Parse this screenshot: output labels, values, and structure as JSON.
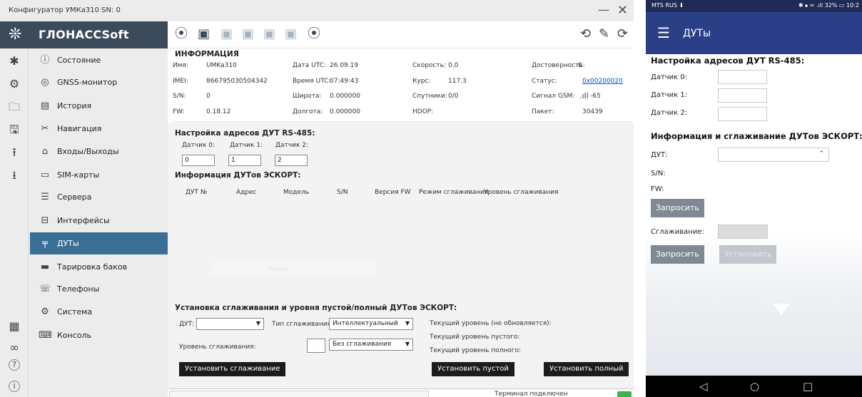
{
  "window": {
    "title": "Конфигуратор     УМКа310 SN: 0",
    "minimize": "—",
    "close": "✕"
  },
  "sidebar": {
    "logo_icon": "snowflake-logo-icon",
    "logo_text": "ГЛОНАССSoft",
    "rail": [
      {
        "icon": "bluetooth-icon",
        "glyph": "✱"
      },
      {
        "icon": "device-icon",
        "glyph": "⚙"
      },
      {
        "icon": "folder-icon",
        "glyph": "🗀"
      },
      {
        "icon": "save-icon",
        "glyph": "🖫"
      },
      {
        "icon": "upload-icon",
        "glyph": "⭱"
      },
      {
        "icon": "download-icon",
        "glyph": "⭳"
      },
      {
        "icon": "grid-icon",
        "glyph": "▦"
      },
      {
        "icon": "link-icon",
        "glyph": "∞"
      },
      {
        "icon": "help-icon",
        "glyph": "?"
      },
      {
        "icon": "info-icon",
        "glyph": "i"
      }
    ],
    "items": [
      {
        "label": "Состояние",
        "icon": "info-circle-icon",
        "glyph": "ⓘ"
      },
      {
        "label": "GNSS-монитор",
        "icon": "satellite-icon",
        "glyph": "◎"
      },
      {
        "label": "История",
        "icon": "book-icon",
        "glyph": "▤"
      },
      {
        "label": "Навигация",
        "icon": "navigation-icon",
        "glyph": "✂"
      },
      {
        "label": "Входы/Выходы",
        "icon": "io-icon",
        "glyph": "⌂"
      },
      {
        "label": "SIM-карты",
        "icon": "sim-card-icon",
        "glyph": "▭"
      },
      {
        "label": "Сервера",
        "icon": "server-icon",
        "glyph": "☰"
      },
      {
        "label": "Интерфейсы",
        "icon": "interface-icon",
        "glyph": "⊟"
      },
      {
        "label": "ДУТы",
        "icon": "fuel-sensor-icon",
        "glyph": "╤"
      },
      {
        "label": "Тарировка баков",
        "icon": "tank-icon",
        "glyph": "▬"
      },
      {
        "label": "Телефоны",
        "icon": "phone-icon",
        "glyph": "☏"
      },
      {
        "label": "Система",
        "icon": "system-gear-icon",
        "glyph": "⚙"
      },
      {
        "label": "Консоль",
        "icon": "console-icon",
        "glyph": "⌨"
      }
    ],
    "active_index": 8
  },
  "toolbar": {
    "left_icons": [
      {
        "icon": "wireless-device-icon",
        "glyph": "📶"
      },
      {
        "icon": "chip-read-icon",
        "glyph": "▣"
      },
      {
        "icon": "chip-write-icon",
        "glyph": "▣"
      },
      {
        "icon": "chip-icon",
        "glyph": "▣"
      },
      {
        "icon": "chip-upload-icon",
        "glyph": "▣"
      },
      {
        "icon": "chip-settings-icon",
        "glyph": "▣"
      },
      {
        "icon": "location-off-icon",
        "glyph": "⦿"
      }
    ],
    "right_icons": [
      {
        "icon": "refresh-doc-icon",
        "glyph": "⟲"
      },
      {
        "icon": "satellite-dish-icon",
        "glyph": "✎"
      },
      {
        "icon": "play-replay-icon",
        "glyph": "⟳"
      }
    ]
  },
  "info": {
    "title": "ИНФОРМАЦИЯ",
    "name_label": "Имя:",
    "name": "UMKa310",
    "imei_label": "IMEI:",
    "imei": "866795030504342",
    "sn_label": "S/N:",
    "sn": "0",
    "fw_label": "FW:",
    "fw": "0.18.12",
    "date_label": "Дата UTC:",
    "date": "26.09.19",
    "time_label": "Время UTC:",
    "time": "07:49:43",
    "lat_label": "Широта:",
    "lat": "0.000000",
    "lon_label": "Долгота:",
    "lon": "0.000000",
    "speed_label": "Скорость:",
    "speed": "0.0",
    "course_label": "Курс:",
    "course": "117.3",
    "sats_label": "Спутники:",
    "sats": "0/0",
    "hdop_label": "HDOP:",
    "hdop": "",
    "valid_label": "Достоверность:",
    "valid": "0",
    "status_label": "Статус:",
    "status": "0x00200020",
    "gsm_label": "Сигнал GSM:",
    "gsm": "-65",
    "packet_label": "Пакет:",
    "packet": "30439"
  },
  "rs485": {
    "title": "Настройка адресов ДУТ RS-485:",
    "sensors": [
      {
        "label": "Датчик 0:",
        "value": "0"
      },
      {
        "label": "Датчик 1:",
        "value": "1"
      },
      {
        "label": "Датчик 2:",
        "value": "2"
      }
    ]
  },
  "escort_info": {
    "title": "Информация ДУТов ЭСКОРТ:",
    "columns": [
      "ДУТ №",
      "Адрес",
      "Модель",
      "S/N",
      "Версия FW",
      "Режим сглаживания",
      "Уровень сглаживания"
    ],
    "ghost_text": "Опрос"
  },
  "smoothing": {
    "title": "Установка сглаживания и уровня пустой/полный ДУТов ЭСКОРТ:",
    "dut_label": "ДУТ:",
    "dut_value": "",
    "type_label": "Тип сглаживания:",
    "type_value": "Интеллектуальный",
    "level_label": "Уровень сглаживания:",
    "level_value": "",
    "mode_value": "Без сглаживания",
    "current_level": "Текущий уровень (не обновляется):",
    "current_empty": "Текущий уровень пустого:",
    "current_full": "Текущий уровень полного:",
    "btn_set_smoothing": "Установить сглаживание",
    "btn_set_empty": "Установить пустой",
    "btn_set_full": "Установить полный"
  },
  "statusbar": {
    "text": "Терминал подключен",
    "led_color": "#3bb54a"
  },
  "phone": {
    "carrier": "MTS RUS ⬇",
    "status_right": "✱ ⦁ ≈ .ıll 32% ▭ 10:2",
    "title": "ДУТы",
    "rs485_title": "Настройка адресов ДУТ RS-485:",
    "sensors": [
      "Датчик 0:",
      "Датчик 1:",
      "Датчик 2:"
    ],
    "escort_title": "Информация и сглаживание ДУТов ЭСКОРТ:",
    "dut_label": "ДУТ:",
    "sn_label": "S/N:",
    "fw_label": "FW:",
    "btn_request_1": "Запросить",
    "smoothing_label": "Сглаживание:",
    "btn_request_2": "Запросить",
    "btn_set": "Установить",
    "nav_back": "◁",
    "nav_home": "○",
    "nav_recent": "□",
    "appbar_color": "#2b3f86"
  }
}
